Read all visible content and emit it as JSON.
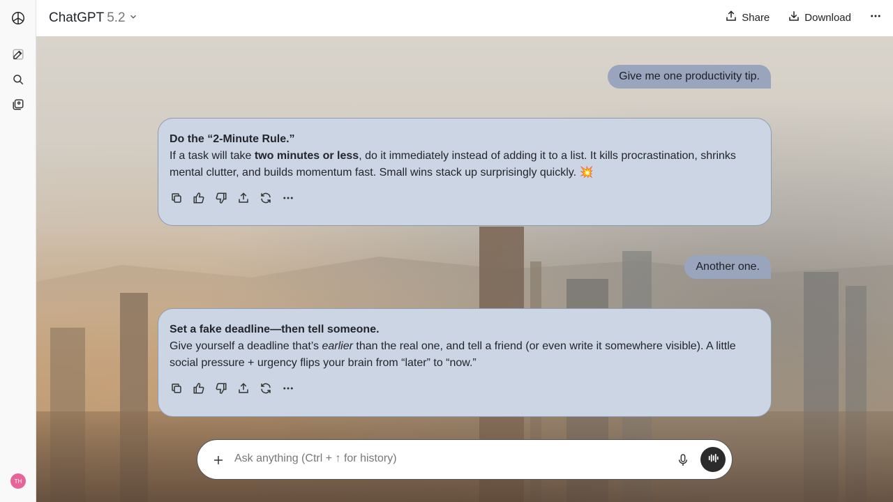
{
  "sidebar": {
    "icons": [
      "openai-logo-icon",
      "new-chat-icon",
      "search-icon",
      "library-icon"
    ],
    "avatar_initials": "TH",
    "avatar_color": "#e6649a"
  },
  "header": {
    "app_name": "ChatGPT",
    "model_version": "5.2",
    "share_label": "Share",
    "download_label": "Download"
  },
  "conversation": {
    "user_1": "Give me one productivity tip.",
    "ai_1": {
      "title": "Do the “2-Minute Rule.”",
      "text_a": "If a task will take ",
      "bold": "two minutes or less",
      "text_b": ", do it immediately instead of adding it to a list. It kills procrastination, shrinks mental clutter, and builds momentum fast. Small wins stack up surprisingly quickly. 💥"
    },
    "user_2": "Another one.",
    "ai_2": {
      "title": "Set a fake deadline—then tell someone.",
      "text_a": "Give yourself a deadline that’s ",
      "italic": "earlier",
      "text_b": " than the real one, and tell a friend (or even write it somewhere visible). A little social pressure + urgency flips your brain from “later” to “now.”"
    }
  },
  "composer": {
    "placeholder": "Ask anything (Ctrl + ↑ for history)"
  },
  "colors": {
    "user_bubble": "#98a5bd",
    "ai_card": "#cbd5e3"
  }
}
